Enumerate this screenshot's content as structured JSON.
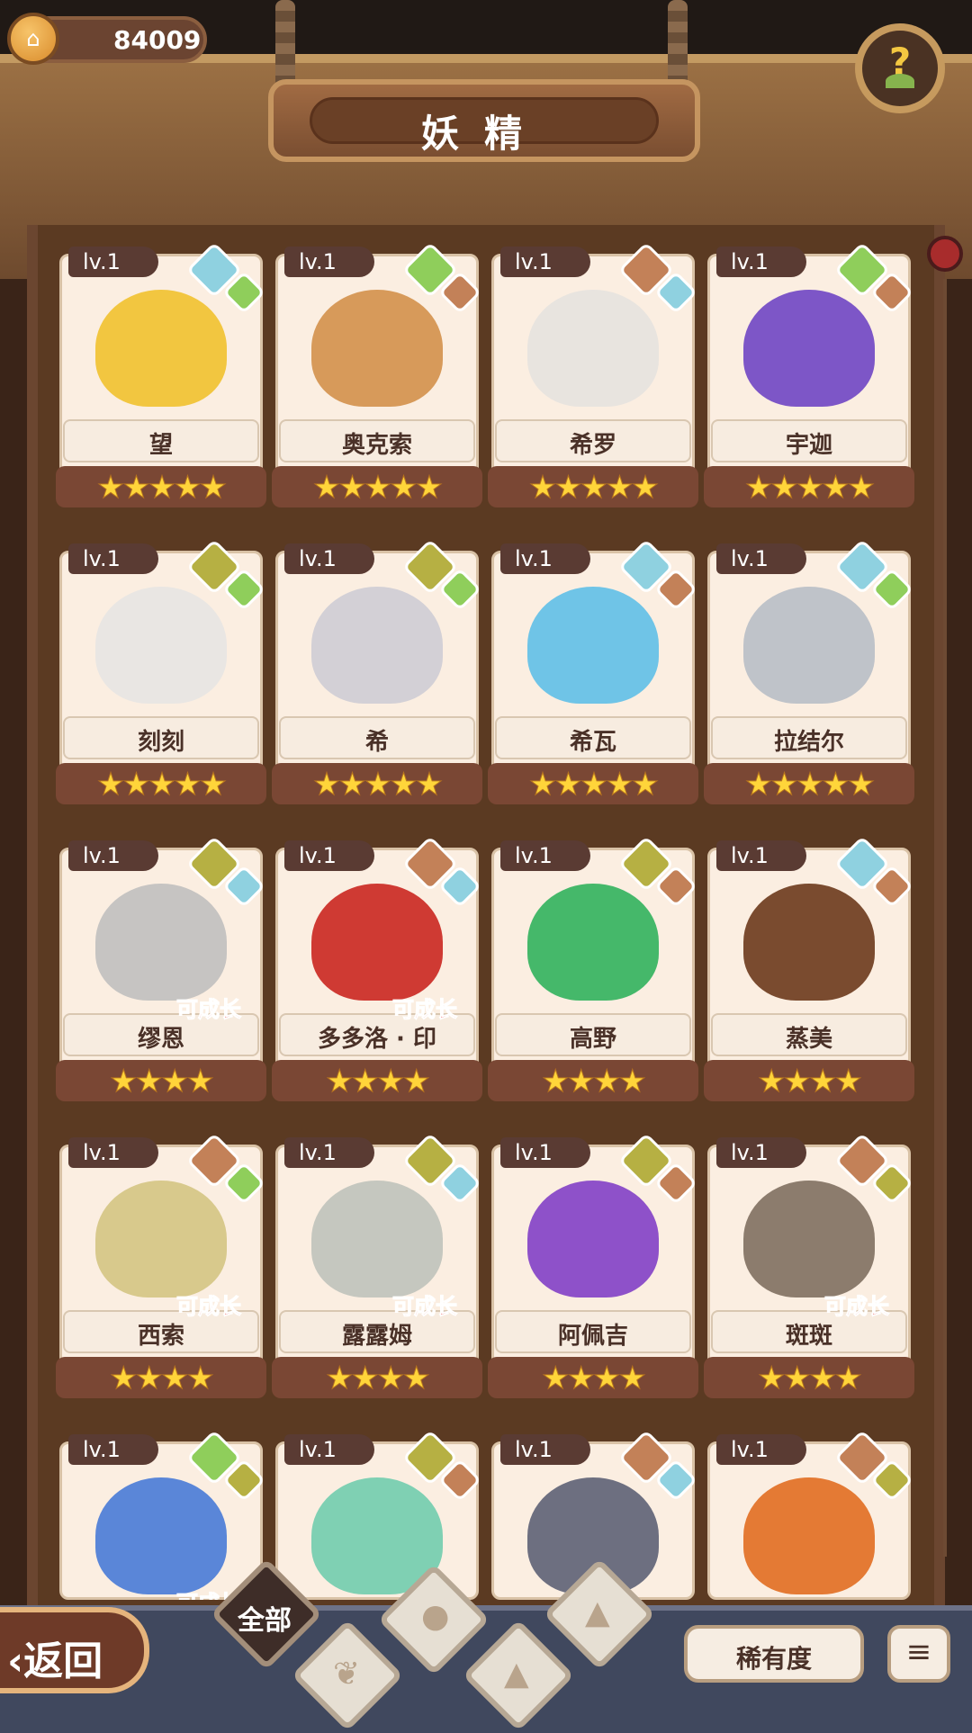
{
  "header": {
    "coins": "84009",
    "title": "妖精",
    "help_icon": "question-mark-sprout-icon"
  },
  "bottom_bar": {
    "back_label": "返回",
    "filters": [
      "全部",
      "植物",
      "水",
      "岩石",
      "火山"
    ],
    "filter_icons": [
      "sprout-icon",
      "water-drop-icon",
      "rock-icon",
      "mountain-icon"
    ],
    "selected_filter": "全部",
    "rarity_label": "稀有度",
    "sort_icon": "sort-icon"
  },
  "cards": [
    {
      "level": "lv.1",
      "name": "望",
      "stars": "★★★★★",
      "grow": "",
      "gems": [
        "water",
        "plant"
      ],
      "color": "#f2c640"
    },
    {
      "level": "lv.1",
      "name": "奥克索",
      "stars": "★★★★★",
      "grow": "",
      "gems": [
        "plant",
        "rock"
      ],
      "color": "#d79a5a"
    },
    {
      "level": "lv.1",
      "name": "希罗",
      "stars": "★★★★★",
      "grow": "",
      "gems": [
        "rock",
        "water"
      ],
      "color": "#e8e4df"
    },
    {
      "level": "lv.1",
      "name": "宇迦",
      "stars": "★★★★★",
      "grow": "",
      "gems": [
        "plant",
        "rock"
      ],
      "color": "#7d56c7"
    },
    {
      "level": "lv.1",
      "name": "刻刻",
      "stars": "★★★★★",
      "grow": "",
      "gems": [
        "earth",
        "plant"
      ],
      "color": "#e9e6e3"
    },
    {
      "level": "lv.1",
      "name": "希",
      "stars": "★★★★★",
      "grow": "",
      "gems": [
        "earth",
        "plant"
      ],
      "color": "#d3d0d6"
    },
    {
      "level": "lv.1",
      "name": "希瓦",
      "stars": "★★★★★",
      "grow": "",
      "gems": [
        "water",
        "rock"
      ],
      "color": "#6fc4e7"
    },
    {
      "level": "lv.1",
      "name": "拉结尔",
      "stars": "★★★★★",
      "grow": "",
      "gems": [
        "water",
        "plant"
      ],
      "color": "#bfc3c9"
    },
    {
      "level": "lv.1",
      "name": "缪恩",
      "stars": "★★★★",
      "grow": "可成长",
      "gems": [
        "earth",
        "water"
      ],
      "color": "#c6c4c2"
    },
    {
      "level": "lv.1",
      "name": "多多洛 · 印",
      "stars": "★★★★",
      "grow": "可成长",
      "gems": [
        "rock",
        "water"
      ],
      "color": "#cf3a33"
    },
    {
      "level": "lv.1",
      "name": "高野",
      "stars": "★★★★",
      "grow": "",
      "gems": [
        "earth",
        "rock"
      ],
      "color": "#45b86a"
    },
    {
      "level": "lv.1",
      "name": "蒸美",
      "stars": "★★★★",
      "grow": "",
      "gems": [
        "water",
        "rock"
      ],
      "color": "#7a4b2f"
    },
    {
      "level": "lv.1",
      "name": "西索",
      "stars": "★★★★",
      "grow": "可成长",
      "gems": [
        "rock",
        "plant"
      ],
      "color": "#d8c98c"
    },
    {
      "level": "lv.1",
      "name": "露露姆",
      "stars": "★★★★",
      "grow": "可成长",
      "gems": [
        "earth",
        "water"
      ],
      "color": "#c5c7bf"
    },
    {
      "level": "lv.1",
      "name": "阿佩吉",
      "stars": "★★★★",
      "grow": "",
      "gems": [
        "earth",
        "rock"
      ],
      "color": "#8e51c9"
    },
    {
      "level": "lv.1",
      "name": "斑斑",
      "stars": "★★★★",
      "grow": "可成长",
      "gems": [
        "rock",
        "earth"
      ],
      "color": "#8c7c6d"
    },
    {
      "level": "lv.1",
      "name": "",
      "stars": "",
      "grow": "可成长",
      "gems": [
        "plant",
        "earth"
      ],
      "color": "#5a86d8"
    },
    {
      "level": "lv.1",
      "name": "",
      "stars": "",
      "grow": "",
      "gems": [
        "earth",
        "rock"
      ],
      "color": "#7fd0b3"
    },
    {
      "level": "lv.1",
      "name": "",
      "stars": "",
      "grow": "",
      "gems": [
        "rock",
        "water"
      ],
      "color": "#6d6f80"
    },
    {
      "level": "lv.1",
      "name": "",
      "stars": "",
      "grow": "",
      "gems": [
        "rock",
        "earth"
      ],
      "color": "#e47a34"
    }
  ]
}
